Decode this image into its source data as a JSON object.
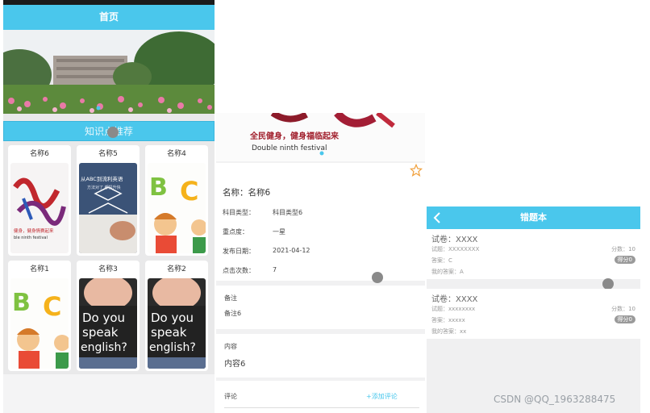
{
  "home": {
    "title": "首页",
    "section_title": "知识点推荐",
    "cards": [
      {
        "name": "名称6"
      },
      {
        "name": "名称5"
      },
      {
        "name": "名称4"
      },
      {
        "name": "名称1"
      },
      {
        "name": "名称3"
      },
      {
        "name": "名称2"
      }
    ],
    "card_images": {
      "festival_line1": "健身，健身情赛起来",
      "festival_line2": "ble ninth festival",
      "english_banner": "从ABC到流利英语",
      "english_sub": "方法对了 都提升快",
      "speak_text": [
        "Do you",
        "speak",
        "english?"
      ]
    }
  },
  "detail": {
    "hero_title": "全民健身，健身福临起来",
    "hero_subtitle": "Double ninth festival",
    "name_label": "名称：",
    "name_value": "名称6",
    "fields": [
      {
        "label": "科目类型：",
        "value": "科目类型6"
      },
      {
        "label": "重点度：",
        "value": "一星"
      },
      {
        "label": "发布日期：",
        "value": "2021-04-12"
      },
      {
        "label": "点击次数：",
        "value": "7"
      }
    ],
    "remark_label": "备注",
    "remark_value": "备注6",
    "content_label": "内容",
    "content_value": "内容6",
    "comment_label": "评论",
    "add_comment": "+添加评论"
  },
  "wrongbook": {
    "title": "错题本",
    "back_icon": "chevron-left-icon",
    "records": [
      {
        "paper": "试卷：XXXX",
        "question": "试题：XXXXXXXX",
        "answer": "答案：C",
        "my_answer": "我的答案：A",
        "score": "分数：10",
        "badge": "得分0"
      },
      {
        "paper": "试卷：XXXX",
        "question": "试题：xxxxxxxx",
        "answer": "答案：xxxxx",
        "my_answer": "我的答案：xx",
        "score": "分数：10",
        "badge": "得分0"
      }
    ]
  },
  "watermark": "CSDN @QQ_1963288475",
  "colors": {
    "accent": "#4ac7ec",
    "star": "#f0a03c",
    "comment_link": "#4ac7ec"
  }
}
